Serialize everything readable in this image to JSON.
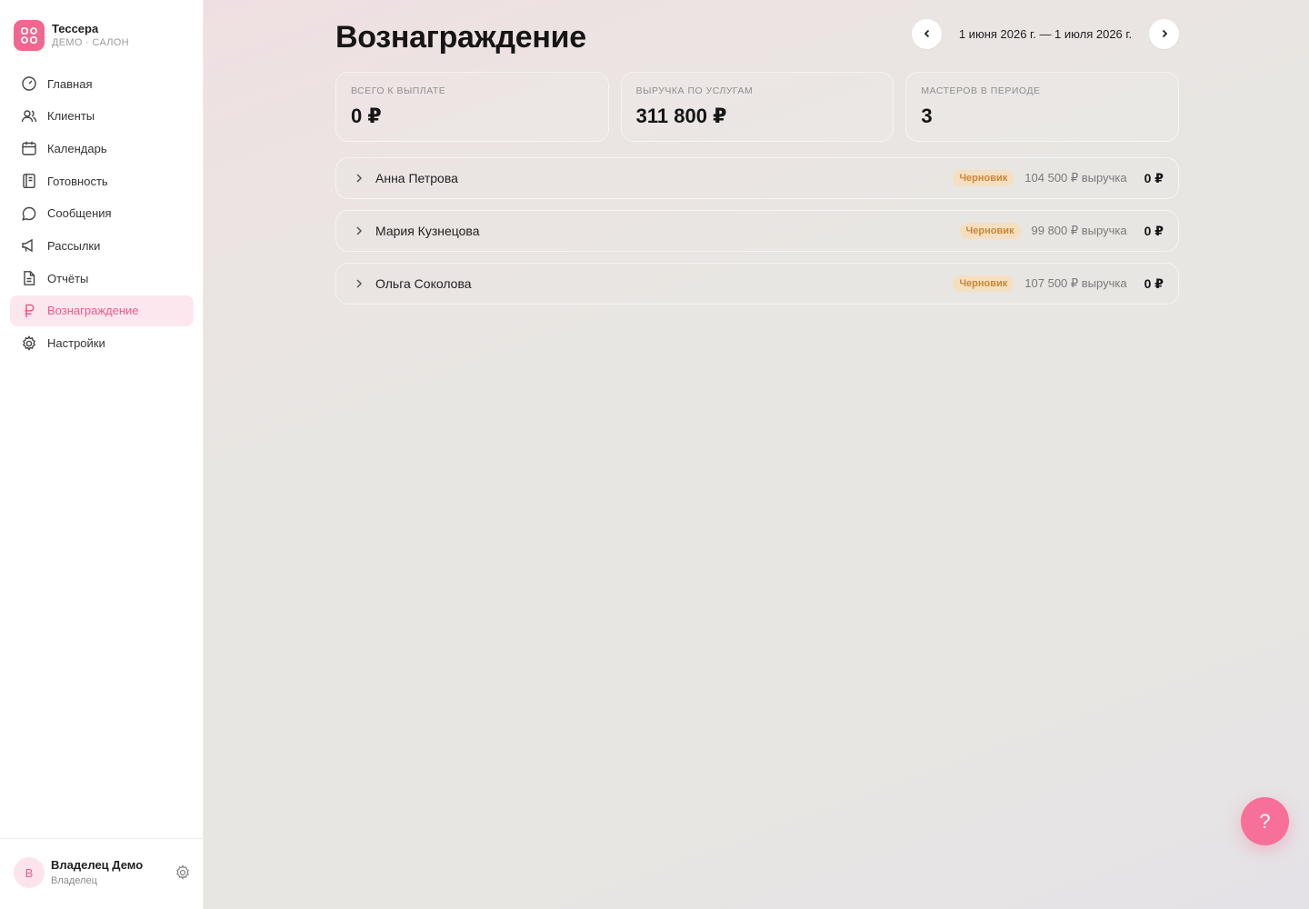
{
  "brand": {
    "title": "Тессера",
    "subtitle": "ДЕМО · САЛОН",
    "logo_color": "#f2668f"
  },
  "nav": [
    {
      "label": "Главная",
      "icon": "gauge-icon",
      "active": false
    },
    {
      "label": "Клиенты",
      "icon": "users-icon",
      "active": false
    },
    {
      "label": "Календарь",
      "icon": "calendar-icon",
      "active": false
    },
    {
      "label": "Готовность",
      "icon": "notebook-icon",
      "active": false
    },
    {
      "label": "Сообщения",
      "icon": "message-icon",
      "active": false
    },
    {
      "label": "Рассылки",
      "icon": "megaphone-icon",
      "active": false
    },
    {
      "label": "Отчёты",
      "icon": "report-icon",
      "active": false
    },
    {
      "label": "Вознаграждение",
      "icon": "ruble-icon",
      "active": true
    },
    {
      "label": "Настройки",
      "icon": "gear-icon",
      "active": false
    }
  ],
  "user": {
    "initial": "В",
    "name": "Владелец Демо",
    "role": "Владелец"
  },
  "page": {
    "title": "Вознаграждение",
    "period": "1 июня 2026 г. — 1 июля 2026 г."
  },
  "stats": [
    {
      "label": "ВСЕГО К ВЫПЛАТЕ",
      "value": "0 ₽"
    },
    {
      "label": "ВЫРУЧКА ПО УСЛУГАМ",
      "value": "311 800 ₽"
    },
    {
      "label": "МАСТЕРОВ В ПЕРИОДЕ",
      "value": "3"
    }
  ],
  "masters": [
    {
      "name": "Анна Петрова",
      "status": "Черновик",
      "revenue": "104 500 ₽ выручка",
      "payout": "0 ₽"
    },
    {
      "name": "Мария Кузнецова",
      "status": "Черновик",
      "revenue": "99 800 ₽ выручка",
      "payout": "0 ₽"
    },
    {
      "name": "Ольга Соколова",
      "status": "Черновик",
      "revenue": "107 500 ₽ выручка",
      "payout": "0 ₽"
    }
  ],
  "help": {
    "label": "?"
  },
  "colors": {
    "accent": "#ec5b86",
    "accent_bg": "#fde7ee",
    "badge_text": "#c9873a",
    "badge_bg": "#f5dfc0",
    "help_button": "#f7709a"
  }
}
